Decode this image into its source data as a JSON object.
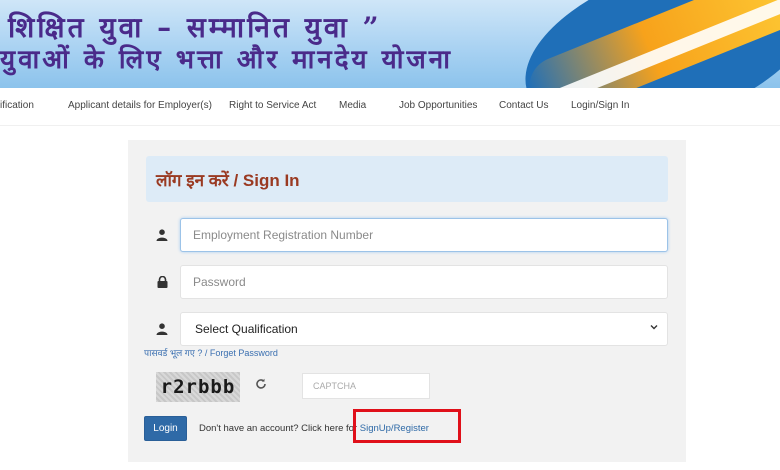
{
  "banner": {
    "line1": "शिक्षित युवा – सम्मानित युवा ”",
    "line2": "युवाओं के लिए भत्ता और मानदेय योजना"
  },
  "nav": {
    "items": [
      "ification",
      "Applicant details for Employer(s)",
      "Right to Service Act",
      "Media",
      "Job Opportunities",
      "Contact Us",
      "Login/Sign In"
    ]
  },
  "login": {
    "title": "लॉग इन करें / Sign In",
    "registration_placeholder": "Employment Registration Number",
    "password_placeholder": "Password",
    "qualification_selected": "Select Qualification",
    "forgot_password": "पासवर्ड भूल गए ? / Forget Password",
    "captcha_text": "r2rbbb",
    "captcha_placeholder": "CAPTCHA",
    "login_button": "Login",
    "no_account_text": "Don't have an account? Click here for",
    "signup_link": "SignUp/Register"
  },
  "icons": {
    "user": "user-icon",
    "lock": "lock-icon",
    "refresh": "refresh-icon",
    "chevron": "chevron-down-icon"
  },
  "colors": {
    "title": "#9a3a22",
    "login_button": "#2f6aa7",
    "highlight": "#e0101a"
  }
}
